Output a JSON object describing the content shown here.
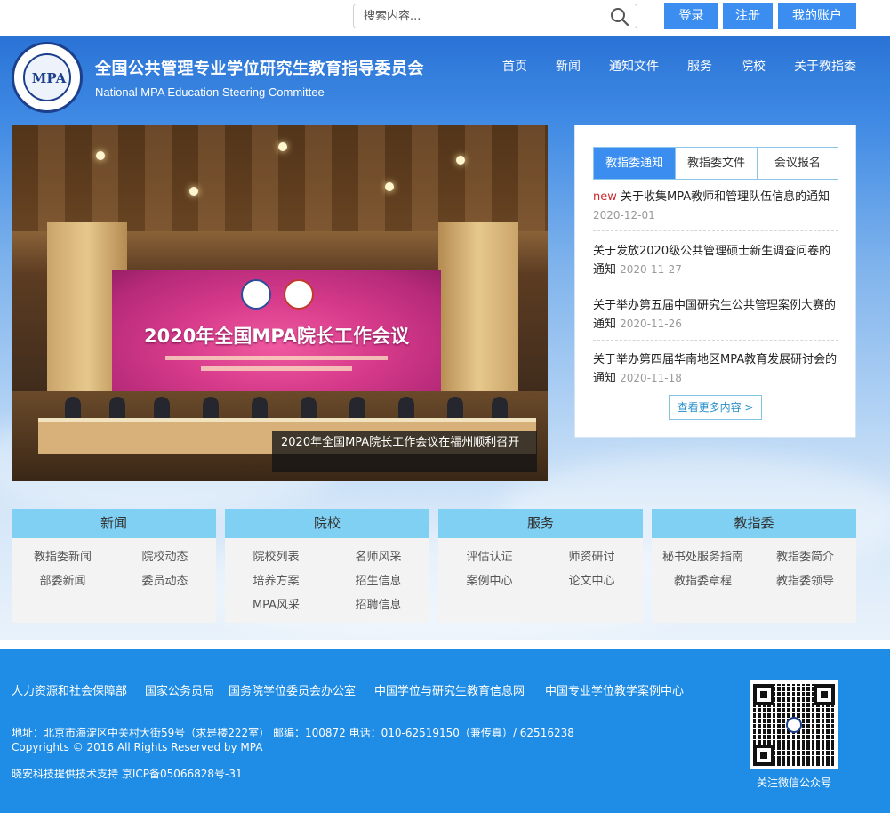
{
  "search": {
    "placeholder": "搜索内容..."
  },
  "auth": {
    "login": "登录",
    "register": "注册",
    "account": "我的账户"
  },
  "site": {
    "title": "全国公共管理专业学位研究生教育指导委员会",
    "subtitle": "National MPA Education Steering Committee",
    "logo_text": "MPA"
  },
  "nav": [
    "首页",
    "新闻",
    "通知文件",
    "服务",
    "院校",
    "关于教指委"
  ],
  "banner": {
    "screen_title": "2020年全国MPA院长工作会议",
    "caption": "2020年全国MPA院长工作会议在福州顺利召开"
  },
  "notice": {
    "tabs": [
      "教指委通知",
      "教指委文件",
      "会议报名"
    ],
    "active_tab": 0,
    "items": [
      {
        "badge": "new",
        "title": "关于收集MPA教师和管理队伍信息的通知",
        "date": "2020-12-01"
      },
      {
        "badge": "",
        "title": "关于发放2020级公共管理硕士新生调查问卷的通知",
        "date": "2020-11-27"
      },
      {
        "badge": "",
        "title": "关于举办第五届中国研究生公共管理案例大赛的通知",
        "date": "2020-11-26"
      },
      {
        "badge": "",
        "title": "关于举办第四届华南地区MPA教育发展研讨会的通知",
        "date": "2020-11-18"
      }
    ],
    "more": "查看更多内容 >"
  },
  "categories": [
    {
      "title": "新闻",
      "links": [
        "教指委新闻",
        "院校动态",
        "部委新闻",
        "委员动态"
      ]
    },
    {
      "title": "院校",
      "links": [
        "院校列表",
        "名师风采",
        "培养方案",
        "招生信息",
        "MPA风采",
        "招聘信息"
      ]
    },
    {
      "title": "服务",
      "links": [
        "评估认证",
        "师资研讨",
        "案例中心",
        "论文中心"
      ]
    },
    {
      "title": "教指委",
      "links": [
        "秘书处服务指南",
        "教指委简介",
        "教指委章程",
        "教指委领导"
      ]
    }
  ],
  "footer": {
    "links": [
      "人力资源和社会保障部",
      "国家公务员局",
      "国务院学位委员会办公室",
      "中国学位与研究生教育信息网",
      "中国专业学位教学案例中心"
    ],
    "address": "地址：北京市海淀区中关村大街59号（求是楼222室） 邮编：100872  电话：010-62519150（兼传真）/ 62516238",
    "copyright": "Copyrights © 2016 All Rights Reserved by MPA",
    "support": "晓安科技提供技术支持    京ICP备05066828号-31",
    "qr_label": "关注微信公众号"
  },
  "colors": {
    "accent": "#3b8ef0",
    "footer": "#1f8ce6",
    "category_head": "#7fd0f3",
    "new_badge": "#c9282d"
  }
}
